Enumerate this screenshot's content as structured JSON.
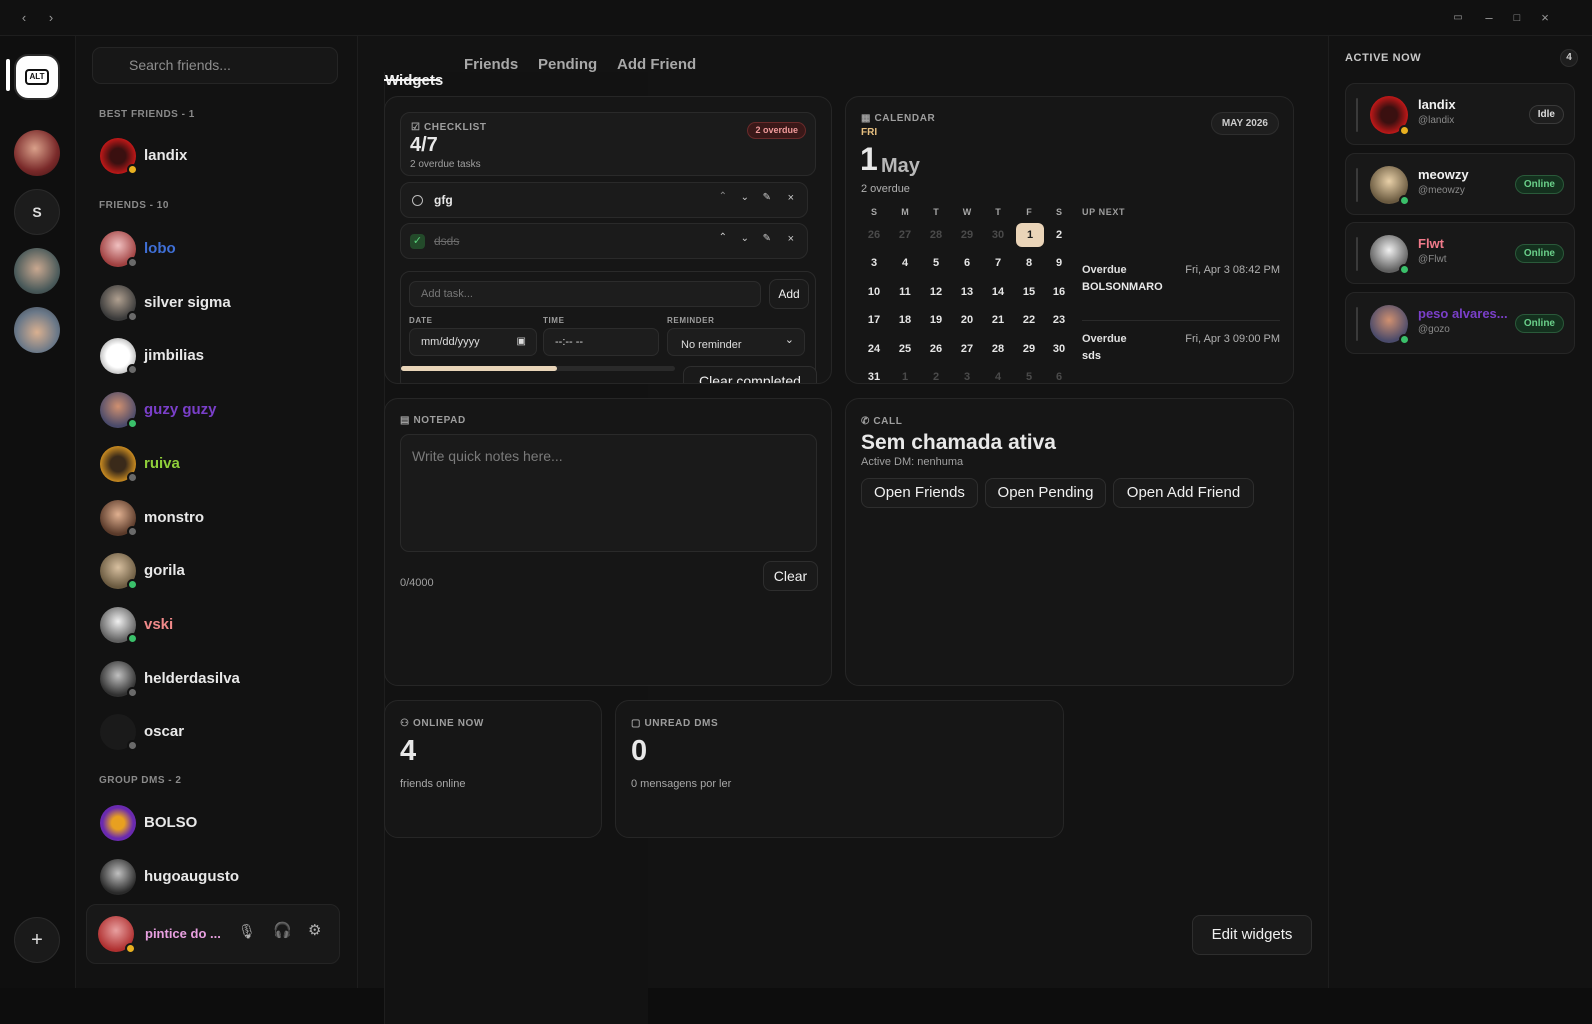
{
  "search": {
    "placeholder": "Search friends..."
  },
  "rail": {
    "app_label": "ALT",
    "letter": "S"
  },
  "sections": {
    "best": "BEST FRIENDS - 1",
    "friends": "FRIENDS - 10",
    "groups": "GROUP DMS - 2"
  },
  "best_friends": [
    {
      "name": "landix",
      "color": "#e8e8e8"
    }
  ],
  "friends": [
    {
      "name": "lobo",
      "color": "#3f6fd6"
    },
    {
      "name": "silver sigma",
      "color": "#e8e8e8"
    },
    {
      "name": "jimbilias",
      "color": "#e8e8e8"
    },
    {
      "name": "guzy guzy",
      "color": "#7a3fc9"
    },
    {
      "name": "ruiva",
      "color": "#8fcf3a"
    },
    {
      "name": "monstro",
      "color": "#e8e8e8"
    },
    {
      "name": "gorila",
      "color": "#e8e8e8"
    },
    {
      "name": "vski",
      "color": "#f08a8a"
    },
    {
      "name": "helderdasilva",
      "color": "#e8e8e8"
    },
    {
      "name": "oscar",
      "color": "#e8e8e8"
    }
  ],
  "groups": [
    {
      "name": "BOLSO"
    },
    {
      "name": "hugoaugusto"
    }
  ],
  "user": {
    "name": "pintice do ..."
  },
  "tabs": [
    "Widgets",
    "Friends",
    "Pending",
    "Add Friend"
  ],
  "checklist": {
    "label": "CHECKLIST",
    "score": "4/7",
    "sub": "2 overdue tasks",
    "badge": "2 overdue",
    "tasks": [
      {
        "text": "gfg",
        "done": false
      },
      {
        "text": "dsds",
        "done": true
      }
    ],
    "add_placeholder": "Add task...",
    "add_button": "Add",
    "date_label": "DATE",
    "date_value": "mm/dd/yyyy",
    "time_label": "TIME",
    "time_value": "--:-- --",
    "reminder_label": "REMINDER",
    "reminder_value": "No reminder",
    "progress": 0.57,
    "clear_button": "Clear completed"
  },
  "calendar": {
    "label": "CALENDAR",
    "month_badge": "MAY 2026",
    "weekday": "FRI",
    "day": "1",
    "month": "May",
    "overdue": "2 overdue",
    "headers": [
      "S",
      "M",
      "T",
      "W",
      "T",
      "F",
      "S"
    ],
    "weeks": [
      [
        "26",
        "27",
        "28",
        "29",
        "30",
        "1",
        "2"
      ],
      [
        "3",
        "4",
        "5",
        "6",
        "7",
        "8",
        "9"
      ],
      [
        "10",
        "11",
        "12",
        "13",
        "14",
        "15",
        "16"
      ],
      [
        "17",
        "18",
        "19",
        "20",
        "21",
        "22",
        "23"
      ],
      [
        "24",
        "25",
        "26",
        "27",
        "28",
        "29",
        "30"
      ],
      [
        "31",
        "1",
        "2",
        "3",
        "4",
        "5",
        "6"
      ]
    ],
    "up_next_label": "UP NEXT",
    "events": [
      {
        "status": "Overdue",
        "title": "BOLSONMARO",
        "when": "Fri, Apr 3 08:42 PM"
      },
      {
        "status": "Overdue",
        "title": "sds",
        "when": "Fri, Apr 3 09:00 PM"
      }
    ]
  },
  "notepad": {
    "label": "NOTEPAD",
    "placeholder": "Write quick notes here...",
    "count": "0/4000",
    "clear": "Clear"
  },
  "call": {
    "label": "CALL",
    "title": "Sem chamada ativa",
    "sub": "Active DM: nenhuma",
    "buttons": [
      "Open Friends",
      "Open Pending",
      "Open Add Friend"
    ]
  },
  "online": {
    "label": "ONLINE NOW",
    "value": "4",
    "sub": "friends online"
  },
  "unread": {
    "label": "UNREAD DMS",
    "value": "0",
    "sub": "0 mensagens por ler"
  },
  "edit_widgets": "Edit widgets",
  "active_now": {
    "title": "ACTIVE NOW",
    "count": "4",
    "users": [
      {
        "name": "landix",
        "handle": "@landix",
        "status": "Idle",
        "name_color": "#f0f0f0"
      },
      {
        "name": "meowzy",
        "handle": "@meowzy",
        "status": "Online",
        "name_color": "#f0f0f0"
      },
      {
        "name": "Flwt",
        "handle": "@Flwt",
        "status": "Online",
        "name_color": "#f07a8a"
      },
      {
        "name": "peso alvares...",
        "handle": "@gozo",
        "status": "Online",
        "name_color": "#7a3fc9"
      }
    ]
  }
}
